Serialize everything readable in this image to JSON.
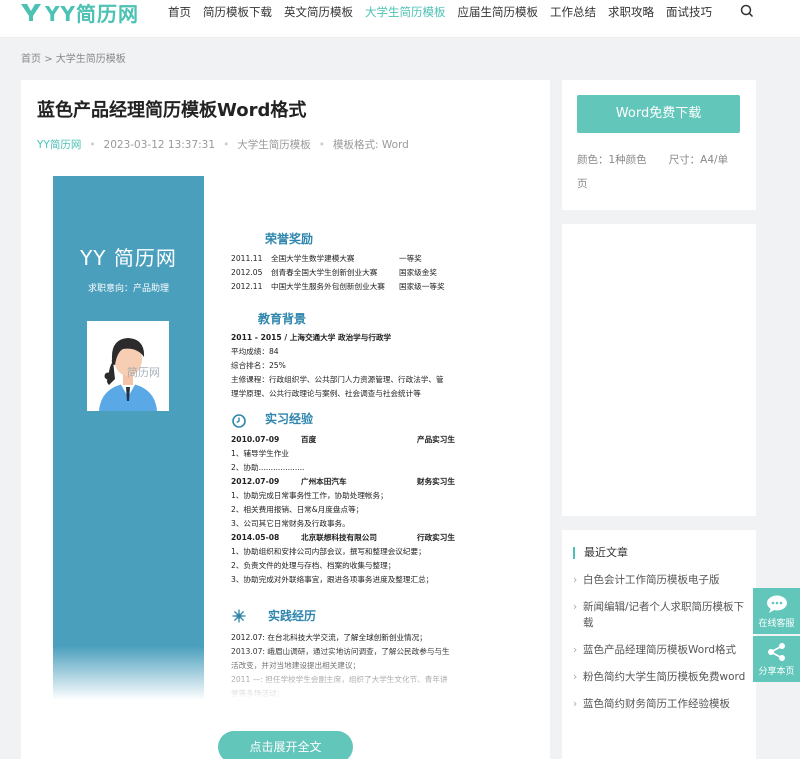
{
  "header": {
    "logo_text": "YY简历网",
    "nav": [
      "首页",
      "简历模板下载",
      "英文简历模板",
      "大学生简历模板",
      "应届生简历模板",
      "工作总结",
      "求职攻略",
      "面试技巧"
    ],
    "active_nav_index": 3
  },
  "breadcrumb": {
    "home": "首页",
    "sep": ">",
    "current": "大学生简历模板"
  },
  "article": {
    "title": "蓝色产品经理简历模板Word格式",
    "author": "YY简历网",
    "datetime": "2023-03-12 13:37:31",
    "category": "大学生简历模板",
    "format": "模板格式: Word"
  },
  "resume": {
    "logo": "YY 简历网",
    "intent": "求职意向：产品助理",
    "photo_watermark": "简历网",
    "awards_title": "荣誉奖励",
    "awards": [
      [
        "2011.11",
        "全国大学生数学建模大赛",
        "一等奖"
      ],
      [
        "2012.05",
        "创青春全国大学生创新创业大赛",
        "国家级金奖"
      ],
      [
        "2012.11",
        "中国大学生服务外包创新创业大赛",
        "国家级一等奖"
      ]
    ],
    "edu_title": "教育背景",
    "edu_lines": [
      "2011 - 2015  / 上海交通大学   政治学与行政学",
      "平均成绩：84",
      "综合排名：25%",
      "主修课程：行政组织学、公共部门人力资源管理、行政法学、管",
      "理学原理、公共行政理论与案例、社会调查与社会统计等"
    ],
    "intern_title": "实习经验",
    "intern_lines": [
      [
        "2010.07-09",
        "百度",
        "产品实习生"
      ],
      [
        "1、辅导学生作业"
      ],
      [
        "2、协助..................."
      ],
      [
        "2012.07-09",
        "广州本田汽车",
        "财务实习生"
      ],
      [
        "1、协助完成日常事务性工作，协助处理帐务；"
      ],
      [
        "2、相关费用报销、日常&月度盘点等；"
      ],
      [
        "3、公司其它日常财务及行政事务。"
      ],
      [
        "2014.05-08",
        "北京联想科技有限公司",
        "行政实习生"
      ],
      [
        "1、协助组织和安排公司内部会议，撰写和整理会议纪要；"
      ],
      [
        "2、负责文件的处理与存档、档案的收集与整理；"
      ],
      [
        "3、协助完成对外联络事宜，跟进各项事务进度及整理汇总；"
      ]
    ],
    "practice_title": "实践经历",
    "practice_lines": [
      "2012.07:  在台北科技大学交流，了解全球创新创业情况；",
      "2013.07:  峨眉山调研，通过实地访问调查，了解公民政参与与生",
      "活改变，并对当地建设提出相关建议；",
      "2011 —:  担任学校学生会副主席，组织了大学生文化节、青年讲",
      "堂等多场活动；"
    ]
  },
  "expand_button": "点击展开全文",
  "download": {
    "button": "Word免费下载",
    "color_label": "颜色：1种颜色",
    "size_label": "尺寸：A4/单",
    "size_label_2": "页"
  },
  "recent": {
    "title": "最近文章",
    "items": [
      "白色会计工作简历模板电子版",
      "新闻编辑/记者个人求职简历模板下载",
      "蓝色产品经理简历模板Word格式",
      "粉色简约大学生简历模板免费word",
      "蓝色简约财务简历工作经验模板"
    ]
  },
  "float": {
    "service": "在线客服",
    "share": "分享本页"
  },
  "colors": {
    "accent": "#4cc2b4",
    "button": "#63c6bb",
    "resume_blue": "#4a9fbd",
    "section_blue": "#2f86ad"
  }
}
